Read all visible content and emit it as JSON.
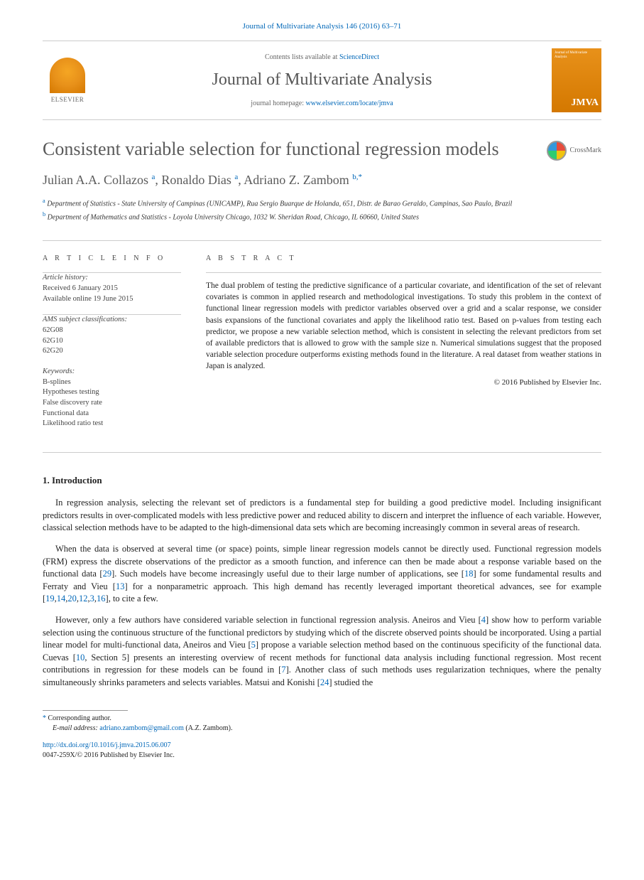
{
  "citation": "Journal of Multivariate Analysis 146 (2016) 63–71",
  "masthead": {
    "publisher": "ELSEVIER",
    "contents_prefix": "Contents lists available at ",
    "contents_link": "ScienceDirect",
    "journal_name": "Journal of Multivariate Analysis",
    "homepage_prefix": "journal homepage: ",
    "homepage_link": "www.elsevier.com/locate/jmva",
    "cover_small": "Journal of Multivariate Analysis",
    "cover_abbrev": "JMVA"
  },
  "crossmark": "CrossMark",
  "title": "Consistent variable selection for functional regression models",
  "authors_parts": {
    "a1": "Julian A.A. Collazos ",
    "a1_aff": "a",
    "sep1": ", ",
    "a2": "Ronaldo Dias ",
    "a2_aff": "a",
    "sep2": ", ",
    "a3": "Adriano Z. Zambom ",
    "a3_aff": "b,",
    "a3_corr": "*"
  },
  "affiliations": {
    "a_label": "a",
    "a_text": " Department of Statistics - State University of Campinas (UNICAMP), Rua Sergio Buarque de Holanda, 651, Distr. de Barao Geraldo, Campinas, Sao Paulo, Brazil",
    "b_label": "b",
    "b_text": " Department of Mathematics and Statistics - Loyola University Chicago, 1032 W. Sheridan Road, Chicago, IL 60660, United States"
  },
  "info": {
    "heading": "A R T I C L E   I N F O",
    "history_title": "Article history:",
    "received": "Received 6 January 2015",
    "online": "Available online 19 June 2015",
    "ams_title": "AMS subject classifications:",
    "ams1": "62G08",
    "ams2": "62G10",
    "ams3": "62G20",
    "keywords_title": "Keywords:",
    "k1": "B-splines",
    "k2": "Hypotheses testing",
    "k3": "False discovery rate",
    "k4": "Functional data",
    "k5": "Likelihood ratio test"
  },
  "abstract": {
    "heading": "A B S T R A C T",
    "text": "The dual problem of testing the predictive significance of a particular covariate, and identification of the set of relevant covariates is common in applied research and methodological investigations. To study this problem in the context of functional linear regression models with predictor variables observed over a grid and a scalar response, we consider basis expansions of the functional covariates and apply the likelihood ratio test. Based on p-values from testing each predictor, we propose a new variable selection method, which is consistent in selecting the relevant predictors from set of available predictors that is allowed to grow with the sample size n. Numerical simulations suggest that the proposed variable selection procedure outperforms existing methods found in the literature. A real dataset from weather stations in Japan is analyzed.",
    "copyright": "© 2016 Published by Elsevier Inc."
  },
  "sections": {
    "intro_heading": "1. Introduction",
    "p1": "In regression analysis, selecting the relevant set of predictors is a fundamental step for building a good predictive model. Including insignificant predictors results in over-complicated models with less predictive power and reduced ability to discern and interpret the influence of each variable. However, classical selection methods have to be adapted to the high-dimensional data sets which are becoming increasingly common in several areas of research.",
    "p2_a": "When the data is observed at several time (or space) points, simple linear regression models cannot be directly used. Functional regression models (FRM) express the discrete observations of the predictor as a smooth function, and inference can then be made about a response variable based on the functional data [",
    "p2_r1": "29",
    "p2_b": "]. Such models have become increasingly useful due to their large number of applications, see [",
    "p2_r2": "18",
    "p2_c": "] for some fundamental results and Ferraty and Vieu [",
    "p2_r3": "13",
    "p2_d": "] for a nonparametric approach. This high demand has recently leveraged important theoretical advances, see for example [",
    "p2_r4": "19",
    "p2_r5": "14",
    "p2_r6": "20",
    "p2_r7": "12",
    "p2_r8": "3",
    "p2_r9": "16",
    "p2_e": "], to cite a few.",
    "p3_a": "However, only a few authors have considered variable selection in functional regression analysis. Aneiros and Vieu [",
    "p3_r1": "4",
    "p3_b": "] show how to perform variable selection using the continuous structure of the functional predictors by studying which of the discrete observed points should be incorporated. Using a partial linear model for multi-functional data, Aneiros and Vieu [",
    "p3_r2": "5",
    "p3_c": "] propose a variable selection method based on the continuous specificity of the functional data. Cuevas [",
    "p3_r3": "10",
    "p3_d": ", Section 5] presents an interesting overview of recent methods for functional data analysis including functional regression. Most recent contributions in regression for these models can be found in [",
    "p3_r4": "7",
    "p3_e": "]. Another class of such methods uses regularization techniques, where the penalty simultaneously shrinks parameters and selects variables. Matsui and Konishi [",
    "p3_r5": "24",
    "p3_f": "] studied the"
  },
  "footnote": {
    "star": "*",
    "corr": " Corresponding author.",
    "email_label": "E-mail address: ",
    "email": "adriano.zambom@gmail.com",
    "email_who": " (A.Z. Zambom)."
  },
  "footer": {
    "doi": "http://dx.doi.org/10.1016/j.jmva.2015.06.007",
    "issn_line": "0047-259X/© 2016 Published by Elsevier Inc."
  }
}
